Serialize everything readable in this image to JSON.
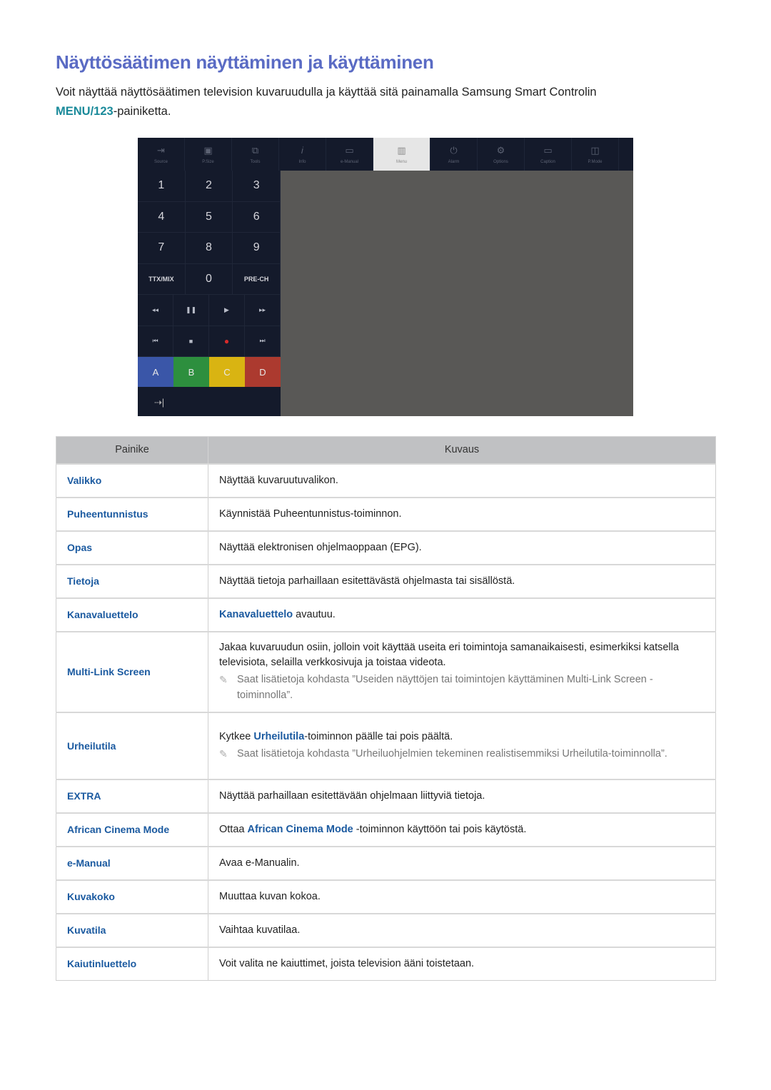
{
  "page": {
    "title": "Näyttösäätimen näyttäminen ja käyttäminen",
    "intro_text": "Voit näyttää näyttösäätimen television kuvaruudulla ja käyttää sitä painamalla Samsung Smart Controlin",
    "intro_highlight": "MENU/123",
    "intro_suffix": "-painiketta."
  },
  "remote": {
    "topbar": [
      {
        "label": "Source",
        "icon": "source-icon",
        "glyph": "⇥"
      },
      {
        "label": "P.Size",
        "icon": "picture-size-icon",
        "glyph": "▣"
      },
      {
        "label": "Tools",
        "icon": "tools-icon",
        "glyph": "⧉"
      },
      {
        "label": "Info",
        "icon": "info-icon",
        "glyph": "𝑖"
      },
      {
        "label": "e-Manual",
        "icon": "emanual-icon",
        "glyph": "▭"
      },
      {
        "label": "Menu",
        "icon": "menu-icon",
        "glyph": "▥",
        "active": true
      },
      {
        "label": "Alarm",
        "icon": "alarm-icon",
        "glyph": "⏻"
      },
      {
        "label": "Options",
        "icon": "options-icon",
        "glyph": "⚙"
      },
      {
        "label": "Caption",
        "icon": "caption-icon",
        "glyph": "▭"
      },
      {
        "label": "P.Mode",
        "icon": "picture-mode-icon",
        "glyph": "◫"
      }
    ],
    "keypad": {
      "numbers": [
        [
          "1",
          "2",
          "3"
        ],
        [
          "4",
          "5",
          "6"
        ],
        [
          "7",
          "8",
          "9"
        ],
        [
          "TTX/MIX",
          "0",
          "PRE-CH"
        ]
      ],
      "media_row1": [
        "◂◂",
        "❚❚",
        "▶",
        "▸▸"
      ],
      "media_row2": [
        "⏮",
        "■",
        "●",
        "⏭"
      ],
      "colors": [
        {
          "label": "A",
          "color": "#3a56a8"
        },
        {
          "label": "B",
          "color": "#2d8f3e"
        },
        {
          "label": "C",
          "color": "#d9b412"
        },
        {
          "label": "D",
          "color": "#ac3a2f"
        }
      ],
      "exit_glyph": "⇢|"
    }
  },
  "table": {
    "headers": [
      "Painike",
      "Kuvaus"
    ],
    "rows": [
      {
        "key": "Valikko",
        "desc": "Näyttää kuvaruutuvalikon."
      },
      {
        "key": "Puheentunnistus",
        "desc": "Käynnistää Puheentunnistus-toiminnon."
      },
      {
        "key": "Opas",
        "desc": "Näyttää elektronisen ohjelmaoppaan (EPG)."
      },
      {
        "key": "Tietoja",
        "desc": "Näyttää tietoja parhaillaan esitettävästä ohjelmasta tai sisällöstä."
      },
      {
        "key": "Kanavaluettelo",
        "desc_blue": "Kanavaluettelo",
        "desc_after": " avautuu."
      },
      {
        "key": "Multi-Link Screen",
        "desc": "Jakaa kuvaruudun osiin, jolloin voit käyttää useita eri toimintoja samanaikaisesti, esimerkiksi katsella televisiota, selailla verkkosivuja ja toistaa videota.",
        "note": "Saat lisätietoja kohdasta ”Useiden näyttöjen tai toimintojen käyttäminen Multi-Link Screen -toiminnolla”."
      },
      {
        "key": "Urheilutila",
        "desc_before": "Kytkee ",
        "desc_blue": "Urheilutila",
        "desc_after": "-toiminnon päälle tai pois päältä.",
        "note": "Saat lisätietoja kohdasta ”Urheiluohjelmien tekeminen realistisemmiksi Urheilutila-toiminnolla”."
      },
      {
        "key": "EXTRA",
        "desc": "Näyttää parhaillaan esitettävään ohjelmaan liittyviä tietoja."
      },
      {
        "key": "African Cinema Mode",
        "desc_before": "Ottaa ",
        "desc_blue": "African Cinema Mode",
        "desc_after": " -toiminnon käyttöön tai pois käytöstä."
      },
      {
        "key": "e-Manual",
        "desc": "Avaa e-Manualin."
      },
      {
        "key": "Kuvakoko",
        "desc": "Muuttaa kuvan kokoa."
      },
      {
        "key": "Kuvatila",
        "desc": "Vaihtaa kuvatilaa."
      },
      {
        "key": "Kaiutinluettelo",
        "desc": "Voit valita ne kaiuttimet, joista television ääni toistetaan."
      }
    ]
  }
}
